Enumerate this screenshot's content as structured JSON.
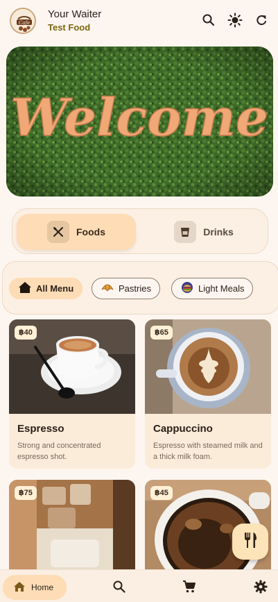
{
  "header": {
    "app_title": "Your Waiter",
    "app_subtitle": "Test Food",
    "logo_text": "Cafe",
    "icons": [
      "search-icon",
      "brightness-icon",
      "refresh-icon"
    ]
  },
  "banner": {
    "text": "Welcome"
  },
  "category_tabs": [
    {
      "label": "Foods",
      "icon": "utensils-icon",
      "selected": true
    },
    {
      "label": "Drinks",
      "icon": "cup-icon",
      "selected": false
    }
  ],
  "filters": [
    {
      "label": "All Menu",
      "icon": "home-icon",
      "selected": true
    },
    {
      "label": "Pastries",
      "icon": "croissant-icon",
      "selected": false
    },
    {
      "label": "Light Meals",
      "icon": "burger-icon",
      "selected": false
    }
  ],
  "products": [
    {
      "name": "Espresso",
      "price": "฿40",
      "description": "Strong and concentrated espresso shot."
    },
    {
      "name": "Cappuccino",
      "price": "฿65",
      "description": "Espresso with steamed milk and a thick milk foam."
    },
    {
      "name": "",
      "price": "฿75",
      "description": ""
    },
    {
      "name": "",
      "price": "฿45",
      "description": ""
    }
  ],
  "bottom_nav": {
    "home_label": "Home",
    "items": [
      "home-icon",
      "search-icon",
      "cart-icon",
      "settings-icon"
    ]
  },
  "colors": {
    "background": "#fdf6f0",
    "accent": "#fddcb6",
    "subtitle": "#7c6612"
  }
}
